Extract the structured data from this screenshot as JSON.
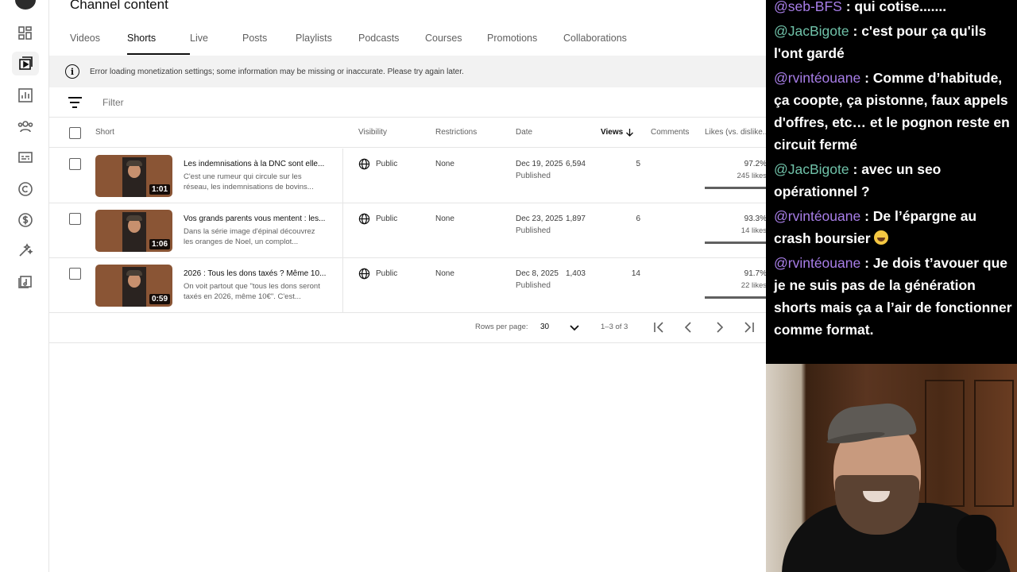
{
  "page_title": "Channel content",
  "tabs": [
    {
      "label": "Videos"
    },
    {
      "label": "Shorts"
    },
    {
      "label": "Live"
    },
    {
      "label": "Posts"
    },
    {
      "label": "Playlists"
    },
    {
      "label": "Podcasts"
    },
    {
      "label": "Courses"
    },
    {
      "label": "Promotions"
    },
    {
      "label": "Collaborations"
    }
  ],
  "active_tab": "Shorts",
  "banner": {
    "text": "Error loading monetization settings; some information may be missing or inaccurate. Please try again later."
  },
  "filter": {
    "placeholder": "Filter"
  },
  "table": {
    "headers": {
      "short": "Short",
      "visibility": "Visibility",
      "restrictions": "Restrictions",
      "date": "Date",
      "views": "Views",
      "comments": "Comments",
      "likes": "Likes (vs. dislike..."
    },
    "rows": [
      {
        "title": "Les indemnisations à la DNC sont elle...",
        "description": "C'est une rumeur qui circule sur les réseau, les indemnisations de bovins...",
        "duration": "1:01",
        "visibility": "Public",
        "restrictions": "None",
        "date": "Dec 19, 2025",
        "status": "Published",
        "views": "6,594",
        "comments": "5",
        "likes_pct": "97.2%",
        "likes_count": "245 likes",
        "likes_fraction": 0.972
      },
      {
        "title": "Vos grands parents vous mentent : les...",
        "description": "Dans la série image d'épinal découvrez les oranges de Noel, un complot...",
        "duration": "1:06",
        "visibility": "Public",
        "restrictions": "None",
        "date": "Dec 23, 2025",
        "status": "Published",
        "views": "1,897",
        "comments": "6",
        "likes_pct": "93.3%",
        "likes_count": "14 likes",
        "likes_fraction": 0.933
      },
      {
        "title": "2026 : Tous les dons taxés ? Même 10...",
        "description": "On voit partout que \"tous les dons seront taxés en 2026, même 10€\". C'est...",
        "duration": "0:59",
        "visibility": "Public",
        "restrictions": "None",
        "date": "Dec 8, 2025",
        "status": "Published",
        "views": "1,403",
        "comments": "14",
        "likes_pct": "91.7%",
        "likes_count": "22 likes",
        "likes_fraction": 0.917
      }
    ]
  },
  "pagination": {
    "rows_per_page_label": "Rows per page:",
    "rows_per_page": "30",
    "range": "1–3 of 3"
  },
  "chat": {
    "messages": [
      {
        "user": "@seb-BFS",
        "sep": " : ",
        "text": "qui cotise.......",
        "color": "#a87ee8"
      },
      {
        "user": "@JacBigote",
        "sep": " : ",
        "text": "c'est pour ça qu'ils l'ont gardé",
        "color": "#6fc1a8"
      },
      {
        "user": "@rvintéouane",
        "sep": " : ",
        "text": "Comme d’habitude, ça coopte, ça pistonne, faux appels d'offres, etc… et le pognon reste en circuit fermé",
        "color": "#a87ee8"
      },
      {
        "user": "@JacBigote",
        "sep": " : ",
        "text": "avec un seo opérationnel ?",
        "color": "#6fc1a8"
      },
      {
        "user": "@rvintéouane",
        "sep": " : ",
        "text": "De l’épargne au crash boursier ",
        "color": "#a87ee8",
        "emoji": "rofl-emoji"
      },
      {
        "user": "@rvintéouane",
        "sep": " : ",
        "text": "Je dois t’avouer que je ne suis pas de la génération shorts mais ça a l’air de fonctionner comme format.",
        "color": "#a87ee8"
      }
    ]
  },
  "icons": [
    "avatar",
    "dashboard-icon",
    "content-icon",
    "analytics-icon",
    "community-icon",
    "subtitles-icon",
    "copyright-icon",
    "earn-icon",
    "customization-icon",
    "audio-library-icon",
    "info-icon",
    "filter-icon",
    "globe-icon",
    "arrow-down-icon",
    "chevron-down-icon",
    "first-page-icon",
    "prev-page-icon",
    "next-page-icon",
    "last-page-icon"
  ]
}
